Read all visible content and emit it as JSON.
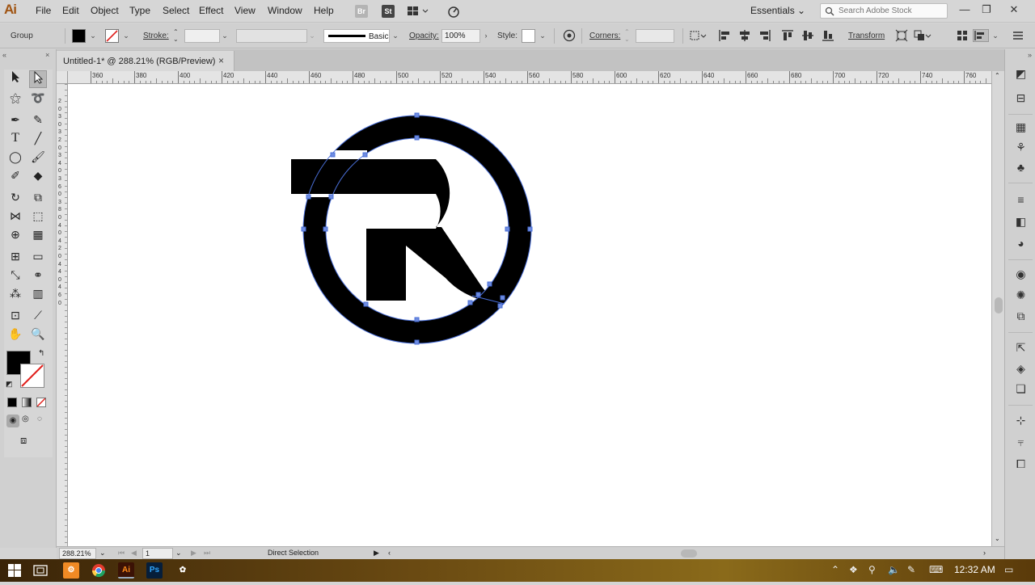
{
  "app": {
    "logo_text": "Ai"
  },
  "menu": [
    "File",
    "Edit",
    "Object",
    "Type",
    "Select",
    "Effect",
    "View",
    "Window",
    "Help"
  ],
  "bridge_label": "Br",
  "stock_label": "St",
  "workspace": "Essentials",
  "search": {
    "placeholder": "Search Adobe Stock"
  },
  "control": {
    "selection_type": "Group",
    "stroke_label": "Stroke:",
    "brush_label": "Basic",
    "opacity_label": "Opacity:",
    "opacity_value": "100%",
    "style_label": "Style:",
    "corners_label": "Corners:",
    "transform_label": "Transform"
  },
  "document": {
    "tab_title": "Untitled-1* @ 288.21% (RGB/Preview)",
    "close_glyph": "×"
  },
  "ruler": {
    "top_ticks": [
      "360",
      "380",
      "400",
      "420",
      "440",
      "460",
      "480",
      "500",
      "520",
      "540",
      "560",
      "580",
      "600",
      "620",
      "640",
      "660",
      "680",
      "700",
      "720",
      "740",
      "760"
    ],
    "left_ticks": [
      "2",
      "0",
      "3",
      "0",
      "3",
      "2",
      "0",
      "3",
      "4",
      "0",
      "3",
      "6",
      "0",
      "3",
      "8",
      "0",
      "4",
      "0",
      "4",
      "2",
      "0",
      "4",
      "4",
      "0",
      "4",
      "6",
      "0"
    ]
  },
  "status": {
    "zoom": "288.21%",
    "artboard": "1",
    "tool_name": "Direct Selection"
  },
  "taskbar": {
    "time": "12:32 AM",
    "ai_label": "Ai",
    "ps_label": "Ps"
  },
  "colors": {
    "artwork": "#000000",
    "selection": "#4a6fd8",
    "accent": "#a05412"
  }
}
